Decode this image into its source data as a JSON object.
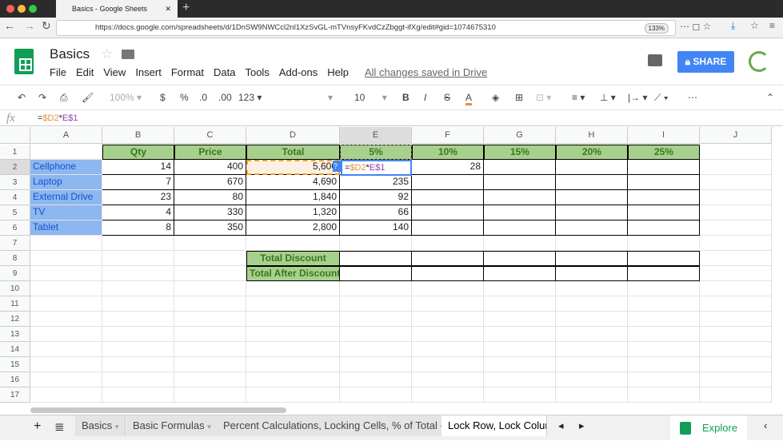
{
  "browser": {
    "tab_title": "Basics - Google Sheets",
    "url": "https://docs.google.com/spreadsheets/d/1DnSW9NWCcl2nl1XzSvGL-mTVnsyFKvdCzZbggt-ifXg/edit#gid=1074675310",
    "zoom": "133%"
  },
  "app": {
    "title": "Basics",
    "menu": [
      "File",
      "Edit",
      "View",
      "Insert",
      "Format",
      "Data",
      "Tools",
      "Add-ons",
      "Help"
    ],
    "saved_status": "All changes saved in Drive",
    "share_label": "SHARE"
  },
  "toolbar": {
    "zoom": "100%",
    "currency": "$",
    "percent": "%",
    "dec_less": ".0",
    "dec_more": ".00",
    "format": "123",
    "font_size": "10"
  },
  "formula_bar": {
    "fx": "fx",
    "prefix": "=",
    "ref1": "$D2",
    "op": "*",
    "ref2": "E$1"
  },
  "columns": [
    "A",
    "B",
    "C",
    "D",
    "E",
    "F",
    "G",
    "H",
    "I",
    "J"
  ],
  "rows": [
    "1",
    "2",
    "3",
    "4",
    "5",
    "6",
    "7",
    "8",
    "9",
    "10",
    "11",
    "12",
    "13",
    "14",
    "15",
    "16",
    "17"
  ],
  "headers": {
    "B": "Qty",
    "C": "Price",
    "D": "Total",
    "E": "5%",
    "F": "10%",
    "G": "15%",
    "H": "20%",
    "I": "25%"
  },
  "items": [
    {
      "name": "Cellphone",
      "qty": "14",
      "price": "400",
      "total": "5,600",
      "p5": "",
      "p10": "28"
    },
    {
      "name": "Laptop",
      "qty": "7",
      "price": "670",
      "total": "4,690",
      "p5": "235",
      "p10": ""
    },
    {
      "name": "External Drive",
      "qty": "23",
      "price": "80",
      "total": "1,840",
      "p5": "92",
      "p10": ""
    },
    {
      "name": "TV",
      "qty": "4",
      "price": "330",
      "total": "1,320",
      "p5": "66",
      "p10": ""
    },
    {
      "name": "Tablet",
      "qty": "8",
      "price": "350",
      "total": "2,800",
      "p5": "140",
      "p10": ""
    }
  ],
  "summary": [
    "Total Discount",
    "Total After Discount"
  ],
  "editor": {
    "help": "?"
  },
  "sheet_tabs": [
    "Basics",
    "Basic Formulas",
    "Percent Calculations, Locking Cells, % of Total",
    "Lock Row, Lock Colum"
  ],
  "explore_label": "Explore",
  "colors": {
    "header_green": "#a8d08d",
    "label_blue": "#8eb6f0",
    "share_blue": "#4285f4",
    "ref_orange": "#e69138",
    "ref_purple": "#8e44ad"
  }
}
